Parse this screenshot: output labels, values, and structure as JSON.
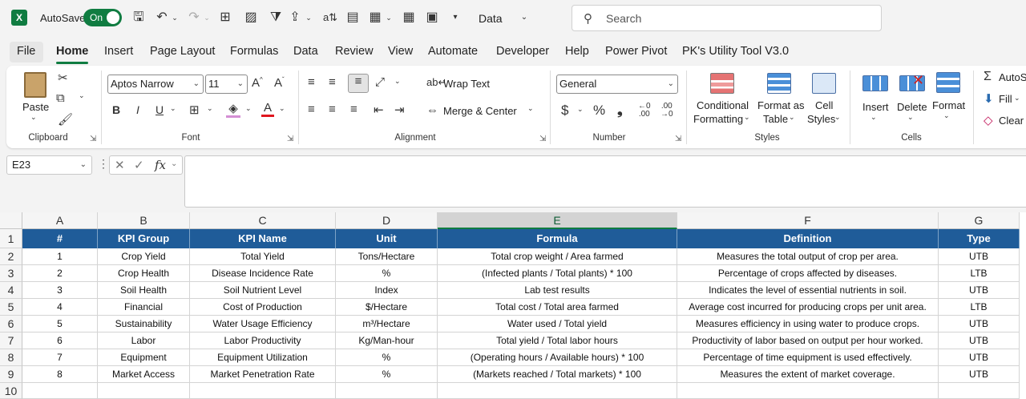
{
  "titlebar": {
    "autosave_label": "AutoSave",
    "autosave_state": "On",
    "file_name": "Data",
    "search_placeholder": "Search"
  },
  "menu": {
    "tabs": [
      "File",
      "Home",
      "Insert",
      "Page Layout",
      "Formulas",
      "Data",
      "Review",
      "View",
      "Automate",
      "Developer",
      "Help",
      "Power Pivot",
      "PK's Utility Tool V3.0"
    ],
    "active": "Home"
  },
  "ribbon": {
    "clipboard": {
      "label": "Clipboard",
      "paste": "Paste"
    },
    "font": {
      "label": "Font",
      "font_name": "Aptos Narrow",
      "font_size": "11"
    },
    "alignment": {
      "label": "Alignment",
      "wrap_text": "Wrap Text",
      "merge_center": "Merge & Center"
    },
    "number": {
      "label": "Number",
      "format": "General"
    },
    "styles": {
      "label": "Styles",
      "conditional_1": "Conditional",
      "conditional_2": "Formatting",
      "format_table_1": "Format as",
      "format_table_2": "Table",
      "cell_styles_1": "Cell",
      "cell_styles_2": "Styles"
    },
    "cells": {
      "label": "Cells",
      "insert": "Insert",
      "delete": "Delete",
      "format": "Format"
    },
    "editing": {
      "autosum": "AutoS",
      "fill": "Fill",
      "clear": "Clear"
    }
  },
  "formula_bar": {
    "name_box": "E23",
    "fx": "fx",
    "value": ""
  },
  "sheet": {
    "columns": [
      "A",
      "B",
      "C",
      "D",
      "E",
      "F",
      "G"
    ],
    "selected_column": "E",
    "row_numbers": [
      "1",
      "2",
      "3",
      "4",
      "5",
      "6",
      "7",
      "8",
      "9",
      "10"
    ],
    "header": [
      "#",
      "KPI Group",
      "KPI Name",
      "Unit",
      "Formula",
      "Definition",
      "Type"
    ],
    "rows": [
      [
        "1",
        "Crop Yield",
        "Total Yield",
        "Tons/Hectare",
        "Total crop weight / Area farmed",
        "Measures the total output of crop per area.",
        "UTB"
      ],
      [
        "2",
        "Crop Health",
        "Disease Incidence Rate",
        "%",
        "(Infected plants / Total plants) * 100",
        "Percentage of crops affected by diseases.",
        "LTB"
      ],
      [
        "3",
        "Soil Health",
        "Soil Nutrient Level",
        "Index",
        "Lab test results",
        "Indicates the level of essential nutrients in soil.",
        "UTB"
      ],
      [
        "4",
        "Financial",
        "Cost of Production",
        "$/Hectare",
        "Total cost / Total area farmed",
        "Average cost incurred for producing crops per unit area.",
        "LTB"
      ],
      [
        "5",
        "Sustainability",
        "Water Usage Efficiency",
        "m³/Hectare",
        "Water used / Total yield",
        "Measures efficiency in using water to produce crops.",
        "UTB"
      ],
      [
        "6",
        "Labor",
        "Labor Productivity",
        "Kg/Man-hour",
        "Total yield / Total labor hours",
        "Productivity of labor based on output per hour worked.",
        "UTB"
      ],
      [
        "7",
        "Equipment",
        "Equipment Utilization",
        "%",
        "(Operating hours / Available hours) * 100",
        "Percentage of time equipment is used effectively.",
        "UTB"
      ],
      [
        "8",
        "Market Access",
        "Market Penetration Rate",
        "%",
        "(Markets reached / Total markets) * 100",
        "Measures the extent of market coverage.",
        "UTB"
      ]
    ]
  },
  "colors": {
    "accent": "#107c41",
    "header_fill": "#1f5c99"
  }
}
